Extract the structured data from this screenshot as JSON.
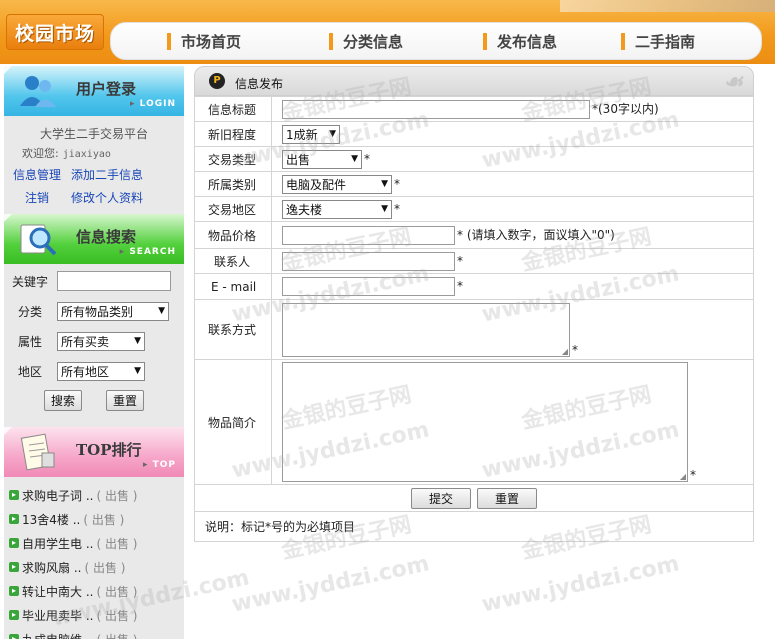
{
  "header": {
    "logo": "校园市场",
    "nav": [
      "市场首页",
      "分类信息",
      "发布信息",
      "二手指南"
    ]
  },
  "sidebar": {
    "login": {
      "title": "用户登录",
      "subtitle": "LOGIN",
      "platform": "大学生二手交易平台",
      "welcome_label": "欢迎您:",
      "username": "jiaxiyao",
      "links": [
        "信息管理",
        "添加二手信息",
        "注销",
        "修改个人资料"
      ]
    },
    "search": {
      "title": "信息搜索",
      "subtitle": "SEARCH",
      "keyword_label": "关键字",
      "keyword_value": "",
      "category_label": "分类",
      "category_value": "所有物品类别",
      "attribute_label": "属性",
      "attribute_value": "所有买卖",
      "area_label": "地区",
      "area_value": "所有地区",
      "search_button": "搜索",
      "reset_button": "重置"
    },
    "top": {
      "title": "TOP排行",
      "subtitle": "TOP",
      "items": [
        {
          "name": "求购电子词 ..",
          "tag": "( 出售 )"
        },
        {
          "name": "13舍4楼 ..",
          "tag": "( 出售 )"
        },
        {
          "name": "自用学生电 ..",
          "tag": "( 出售 )"
        },
        {
          "name": "求购风扇 ..",
          "tag": "( 出售 )"
        },
        {
          "name": "转让中南大 ..",
          "tag": "( 出售 )"
        },
        {
          "name": "毕业甩卖毕 ..",
          "tag": "( 出售 )"
        },
        {
          "name": "九成电脑维 ..",
          "tag": "( 出售 )"
        }
      ]
    }
  },
  "main": {
    "title": "信息发布",
    "fields": {
      "info_title": {
        "label": "信息标题",
        "value": "",
        "hint": "*(30字以内)"
      },
      "condition": {
        "label": "新旧程度",
        "value": "1成新"
      },
      "trade_type": {
        "label": "交易类型",
        "value": "出售",
        "hint": "*"
      },
      "category": {
        "label": "所属类别",
        "value": "电脑及配件",
        "hint": "*"
      },
      "area": {
        "label": "交易地区",
        "value": "逸夫楼",
        "hint": "*"
      },
      "price": {
        "label": "物品价格",
        "value": "",
        "hint": "* (请填入数字，面议填入\"0\")"
      },
      "contact": {
        "label": "联系人",
        "value": "",
        "hint": "*"
      },
      "email": {
        "label": "E - mail",
        "value": "",
        "hint": "*"
      },
      "contact_method": {
        "label": "联系方式",
        "value": "",
        "hint": "*"
      },
      "description": {
        "label": "物品简介",
        "value": "",
        "hint": "*"
      }
    },
    "submit_button": "提交",
    "reset_button": "重置",
    "note": "说明：标记*号的为必填项目"
  },
  "watermark": [
    "金银的豆子网",
    "www.jyddzi.com"
  ],
  "colors": {
    "accent": "#f29a1c",
    "link": "#1a47b8",
    "bullet": "#3aa53a"
  }
}
